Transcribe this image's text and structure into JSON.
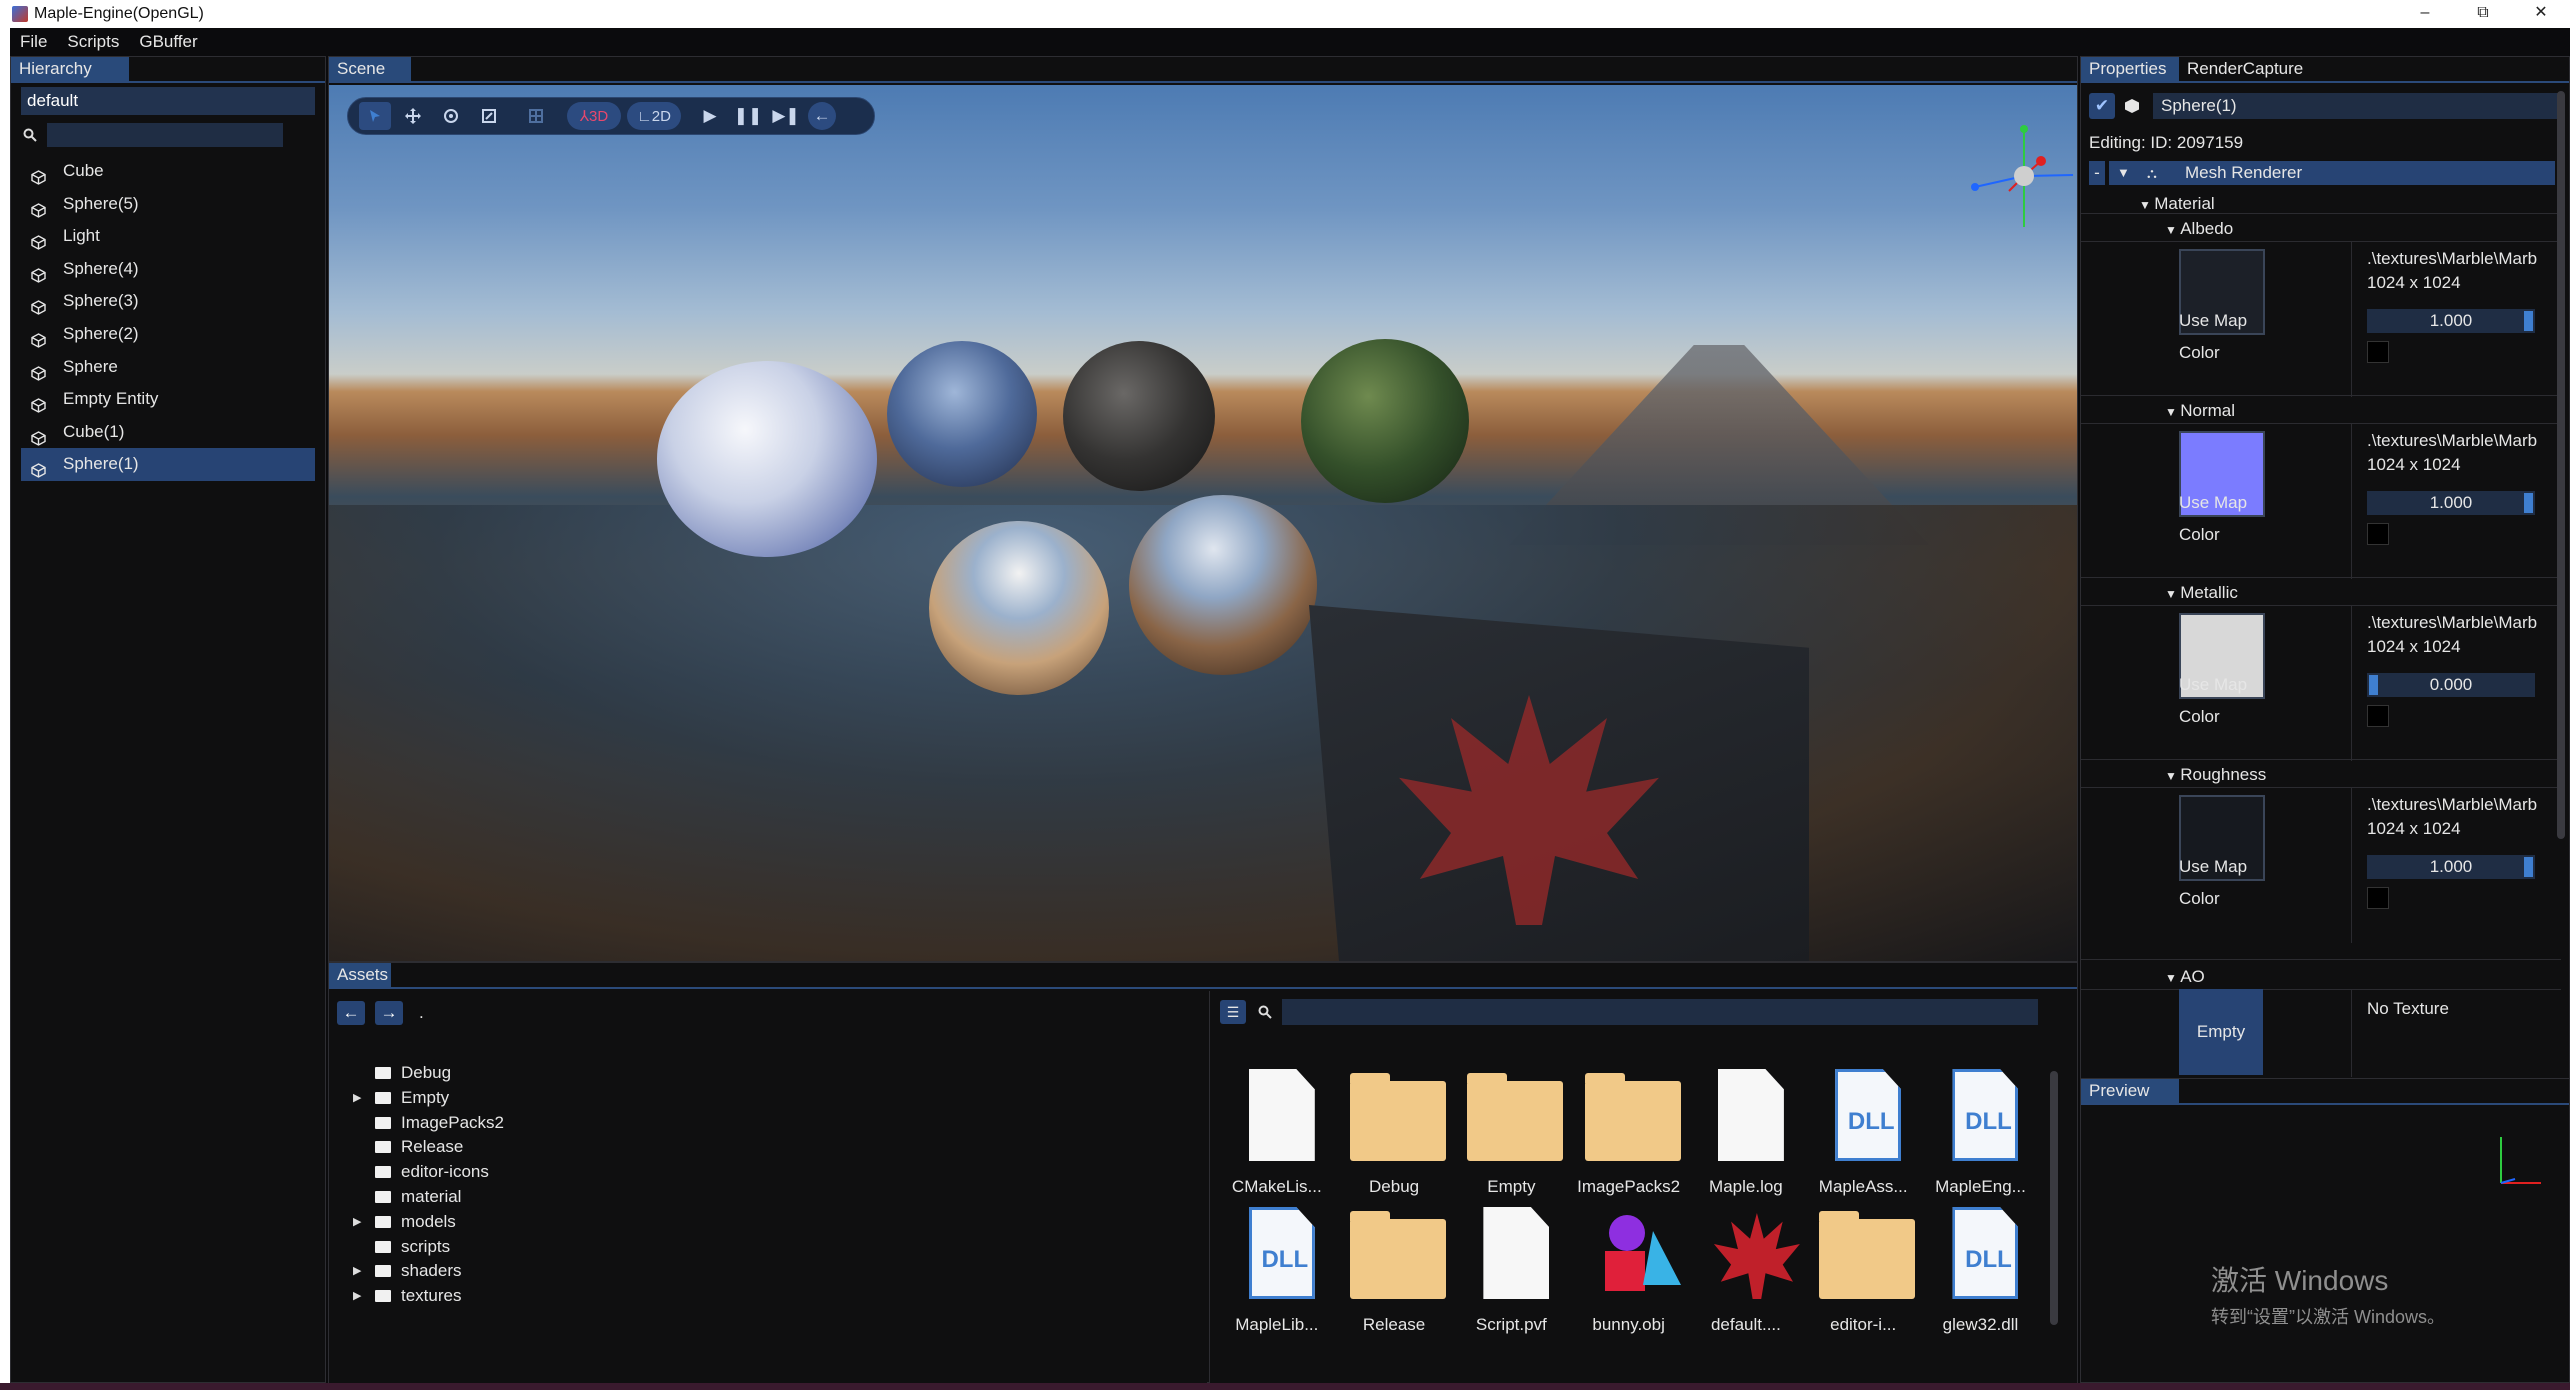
{
  "window": {
    "title": "Maple-Engine(OpenGL)",
    "min": "–",
    "restore": "⧉",
    "close": "✕"
  },
  "menu": [
    "File",
    "Scripts",
    "GBuffer"
  ],
  "hierarchy": {
    "tab": "Hierarchy",
    "filter_value": "default",
    "search_icon": "search-icon",
    "entities": [
      "Cube",
      "Sphere(5)",
      "Light",
      "Sphere(4)",
      "Sphere(3)",
      "Sphere(2)",
      "Sphere",
      "Empty Entity",
      "Cube(1)",
      "Sphere(1)"
    ],
    "selected": "Sphere(1)"
  },
  "scene": {
    "tab": "Scene",
    "toolbar": {
      "select_icon": "cursor-icon",
      "move_icon": "move-icon",
      "rotate_icon": "rotate-icon",
      "scale_icon": "scale-icon",
      "grid_icon": "grid-icon",
      "mode_3d": "3D",
      "mode_2d": "2D",
      "play_icon": "play-icon",
      "pause_icon": "pause-icon",
      "step_icon": "step-icon",
      "back_icon": "back-arrow-icon"
    }
  },
  "assets": {
    "tab": "Assets",
    "path": ".",
    "folders": [
      {
        "name": "Debug",
        "expandable": false
      },
      {
        "name": "Empty",
        "expandable": true
      },
      {
        "name": "ImagePacks2",
        "expandable": false
      },
      {
        "name": "Release",
        "expandable": false
      },
      {
        "name": "editor-icons",
        "expandable": false
      },
      {
        "name": "material",
        "expandable": false
      },
      {
        "name": "models",
        "expandable": true
      },
      {
        "name": "scripts",
        "expandable": false
      },
      {
        "name": "shaders",
        "expandable": true
      },
      {
        "name": "textures",
        "expandable": true
      }
    ],
    "files": [
      {
        "label": "CMakeLis...",
        "kind": "file"
      },
      {
        "label": "Debug",
        "kind": "folder"
      },
      {
        "label": "Empty",
        "kind": "folder"
      },
      {
        "label": "ImagePacks2",
        "kind": "folder"
      },
      {
        "label": "Maple.log",
        "kind": "file"
      },
      {
        "label": "MapleAss...",
        "kind": "dll"
      },
      {
        "label": "MapleEng...",
        "kind": "dll"
      },
      {
        "label": "MapleLib...",
        "kind": "dll"
      },
      {
        "label": "Release",
        "kind": "folder"
      },
      {
        "label": "Script.pvf",
        "kind": "file"
      },
      {
        "label": "bunny.obj",
        "kind": "model"
      },
      {
        "label": "default....",
        "kind": "maple"
      },
      {
        "label": "editor-i...",
        "kind": "folder"
      },
      {
        "label": "glew32.dll",
        "kind": "dll"
      }
    ],
    "dll_text": "DLL"
  },
  "properties": {
    "tabs": [
      "Properties",
      "RenderCapture"
    ],
    "entity_name": "Sphere(1)",
    "editing": "Editing:  ID: 2097159",
    "component": "Mesh Renderer",
    "material": "Material",
    "use_map": "Use Map",
    "color": "Color",
    "sections": [
      {
        "name": "Albedo",
        "path": ".\\textures\\Marble\\Marb",
        "size": "1024 x 1024",
        "value": "1.000",
        "fill": 1.0,
        "thumb": "#1c2028"
      },
      {
        "name": "Normal",
        "path": ".\\textures\\Marble\\Marb",
        "size": "1024 x 1024",
        "value": "1.000",
        "fill": 1.0,
        "thumb": "#7b7cff"
      },
      {
        "name": "Metallic",
        "path": ".\\textures\\Marble\\Marb",
        "size": "1024 x 1024",
        "value": "0.000",
        "fill": 0.0,
        "thumb": "#d8d8d8"
      },
      {
        "name": "Roughness",
        "path": ".\\textures\\Marble\\Marb",
        "size": "1024 x 1024",
        "value": "1.000",
        "fill": 1.0,
        "thumb": "#16191f"
      }
    ],
    "ao": {
      "name": "AO",
      "no_texture": "No Texture",
      "empty": "Empty"
    }
  },
  "preview": {
    "tab": "Preview",
    "watermark_title": "激活 Windows",
    "watermark_sub": "转到“设置”以激活 Windows。"
  }
}
